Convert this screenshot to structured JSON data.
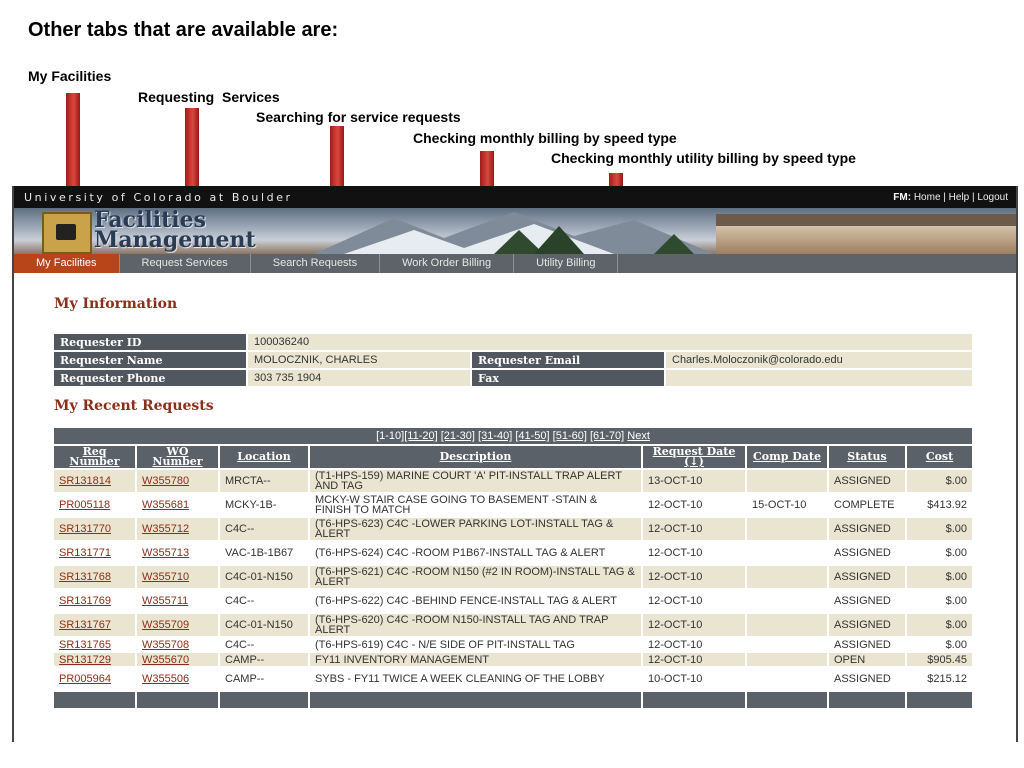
{
  "slide": {
    "title": "Other tabs that are available are:",
    "annotations": [
      "My Facilities",
      "Requesting  Services",
      "Searching for service requests",
      "Checking monthly billing by speed type",
      "Checking monthly utility billing by speed type"
    ]
  },
  "header": {
    "university": "University of Colorado at Boulder",
    "fm_label": "FM:",
    "links": [
      "Home",
      "Help",
      "Logout"
    ],
    "brand_line1": "Facilities",
    "brand_line2": "Management"
  },
  "nav": {
    "tabs": [
      "My Facilities",
      "Request Services",
      "Search Requests",
      "Work Order Billing",
      "Utility Billing"
    ],
    "active": "My Facilities"
  },
  "my_information": {
    "title": "My Information",
    "requester_id_label": "Requester ID",
    "requester_id": "100036240",
    "requester_name_label": "Requester Name",
    "requester_name": "MOLOCZNIK, CHARLES",
    "requester_email_label": "Requester Email",
    "requester_email": "Charles.Moloczonik@colorado.edu",
    "requester_phone_label": "Requester Phone",
    "requester_phone": "303 735 1904",
    "fax_label": "Fax",
    "fax": ""
  },
  "recent_requests": {
    "title": "My Recent Requests",
    "pager": [
      "[1-10]",
      "[11-20]",
      "[21-30]",
      "[31-40]",
      "[41-50]",
      "[51-60]",
      "[61-70]",
      "Next"
    ],
    "headers": [
      "Req Number",
      "WO Number",
      "Location",
      "Description",
      "Request Date (↓)",
      "Comp Date",
      "Status",
      "Cost"
    ],
    "rows": [
      {
        "req": "SR131814",
        "wo": "W355780",
        "loc": "MRCTA--",
        "desc": "(T1-HPS-159) MARINE COURT 'A' PIT-INSTALL TRAP ALERT AND TAG",
        "req_date": "13-OCT-10",
        "comp_date": "",
        "status": "ASSIGNED",
        "cost": "$.00"
      },
      {
        "req": "PR005118",
        "wo": "W355681",
        "loc": "MCKY-1B-",
        "desc": "MCKY-W STAIR CASE GOING TO BASEMENT -STAIN & FINISH TO MATCH",
        "req_date": "12-OCT-10",
        "comp_date": "15-OCT-10",
        "status": "COMPLETE",
        "cost": "$413.92"
      },
      {
        "req": "SR131770",
        "wo": "W355712",
        "loc": "C4C--",
        "desc": "(T6-HPS-623) C4C -LOWER PARKING LOT-INSTALL TAG & ALERT",
        "req_date": "12-OCT-10",
        "comp_date": "",
        "status": "ASSIGNED",
        "cost": "$.00"
      },
      {
        "req": "SR131771",
        "wo": "W355713",
        "loc": "VAC-1B-1B67",
        "desc": "(T6-HPS-624) C4C -ROOM P1B67-INSTALL TAG & ALERT",
        "req_date": "12-OCT-10",
        "comp_date": "",
        "status": "ASSIGNED",
        "cost": "$.00"
      },
      {
        "req": "SR131768",
        "wo": "W355710",
        "loc": "C4C-01-N150",
        "desc": "(T6-HPS-621) C4C -ROOM N150 (#2 IN ROOM)-INSTALL TAG & ALERT",
        "req_date": "12-OCT-10",
        "comp_date": "",
        "status": "ASSIGNED",
        "cost": "$.00"
      },
      {
        "req": "SR131769",
        "wo": "W355711",
        "loc": "C4C--",
        "desc": "(T6-HPS-622) C4C -BEHIND FENCE-INSTALL TAG & ALERT",
        "req_date": "12-OCT-10",
        "comp_date": "",
        "status": "ASSIGNED",
        "cost": "$.00"
      },
      {
        "req": "SR131767",
        "wo": "W355709",
        "loc": "C4C-01-N150",
        "desc": "(T6-HPS-620) C4C -ROOM N150-INSTALL TAG AND TRAP ALERT",
        "req_date": "12-OCT-10",
        "comp_date": "",
        "status": "ASSIGNED",
        "cost": "$.00"
      },
      {
        "req": "SR131765",
        "wo": "W355708",
        "loc": "C4C--",
        "desc": "(T6-HPS-619) C4C - N/E SIDE OF PIT-INSTALL TAG",
        "req_date": "12-OCT-10",
        "comp_date": "",
        "status": "ASSIGNED",
        "cost": "$.00"
      },
      {
        "req": "SR131729",
        "wo": "W355670",
        "loc": "CAMP--",
        "desc": "FY11 INVENTORY MANAGEMENT",
        "req_date": "12-OCT-10",
        "comp_date": "",
        "status": "OPEN",
        "cost": "$905.45"
      },
      {
        "req": "PR005964",
        "wo": "W355506",
        "loc": "CAMP--",
        "desc": "SYBS - FY11 TWICE A WEEK CLEANING OF THE LOBBY",
        "req_date": "10-OCT-10",
        "comp_date": "",
        "status": "ASSIGNED",
        "cost": "$215.12"
      }
    ]
  }
}
